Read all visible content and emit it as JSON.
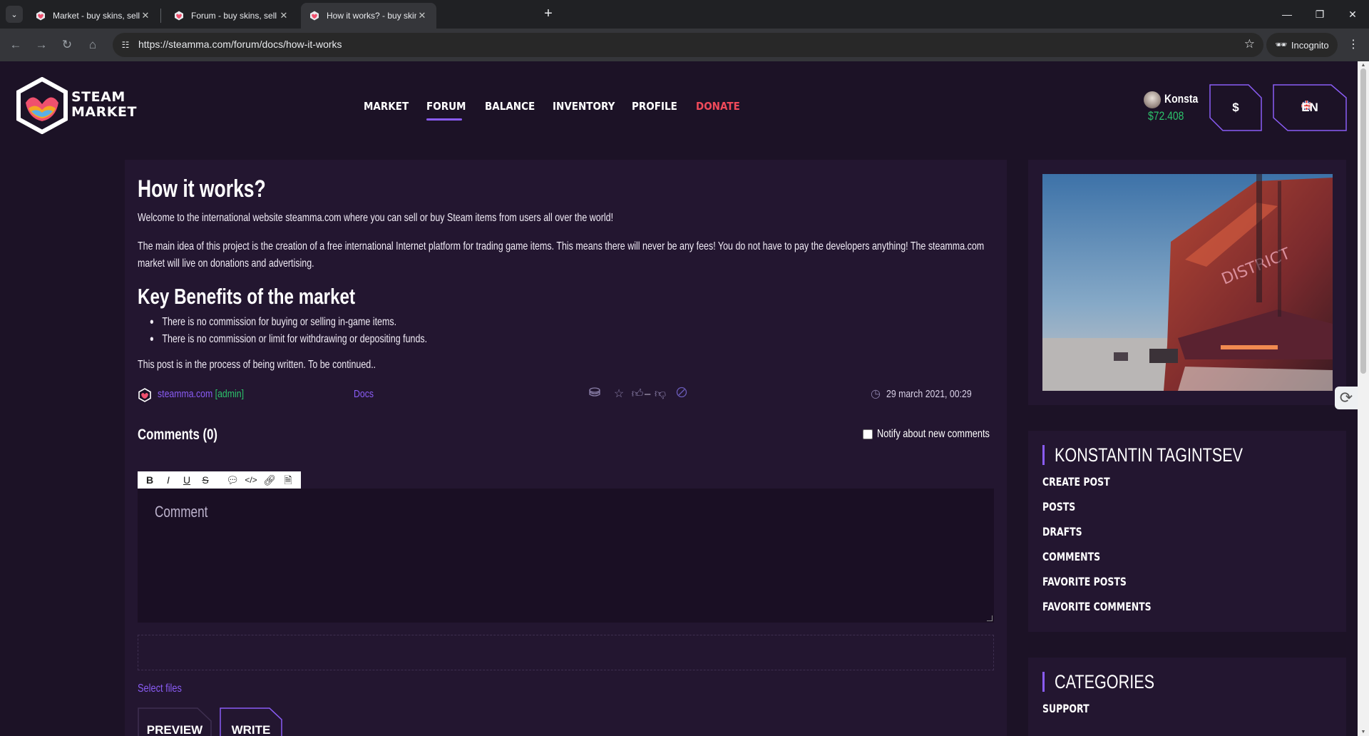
{
  "browser": {
    "tabs": [
      {
        "title": "Market - buy skins, sell skins"
      },
      {
        "title": "Forum - buy skins, sell skins"
      },
      {
        "title": "How it works? - buy skins, sell s"
      }
    ],
    "url": "https://steamma.com/forum/docs/how-it-works",
    "incognito_label": "Incognito"
  },
  "logo": {
    "line1": "STEAM",
    "line2": "MARKET"
  },
  "nav": {
    "market": "MARKET",
    "forum": "FORUM",
    "balance": "BALANCE",
    "inventory": "INVENTORY",
    "profile": "PROFILE",
    "donate": "DONATE"
  },
  "user": {
    "name": "Konsta",
    "balance": "$72.408"
  },
  "header_buttons": {
    "currency": "$",
    "language": "EN"
  },
  "post": {
    "title": "How it works?",
    "p1": "Welcome to the international website steamma.com where you can sell or buy Steam items from users all over the world!",
    "p2": "The main idea of this project is the creation of a free international Internet platform for trading game items. This means there will never be any fees! You do not have to pay the developers anything! The steamma.com market will live on donations and advertising.",
    "subtitle": "Key Benefits of the market",
    "benefits": [
      "There is no commission for buying or selling in-game items.",
      "There is no commission or limit for withdrawing or depositing funds."
    ],
    "p3": "This post is in the process of being written. To be continued..",
    "author": "steamma.com",
    "author_role": "[admin]",
    "category": "Docs",
    "rating": "–",
    "date": "29 march 2021, 00:29"
  },
  "comments": {
    "heading": "Comments (0)",
    "notify_label": "Notify about new comments",
    "placeholder": "Comment",
    "select_files": "Select files",
    "preview_label": "PREVIEW",
    "write_label": "WRITE",
    "toolbar": [
      "B",
      "I",
      "U",
      "S"
    ]
  },
  "sidebar": {
    "user_heading": "KONSTANTIN TAGINTSEV",
    "user_links": [
      "CREATE POST",
      "POSTS",
      "DRAFTS",
      "COMMENTS",
      "FAVORITE POSTS",
      "FAVORITE COMMENTS"
    ],
    "categories_heading": "CATEGORIES",
    "categories": [
      "SUPPORT"
    ],
    "image_sign_text": "DISTRICT"
  },
  "colors": {
    "background": "#1c1226",
    "card": "#231630",
    "accent": "#8a5cf5",
    "donate": "#f04a5a",
    "balance": "#2cc36b"
  }
}
